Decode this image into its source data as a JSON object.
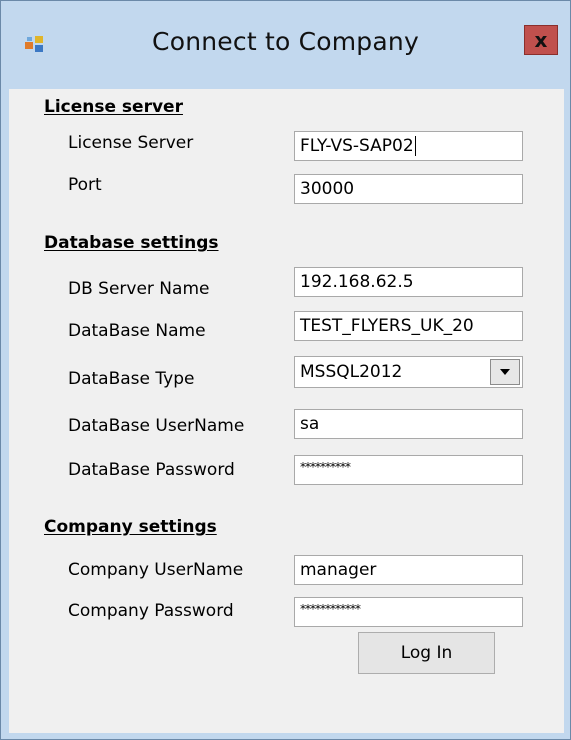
{
  "window": {
    "title": "Connect to Company",
    "close_label": "x"
  },
  "license_server": {
    "heading": "License server",
    "server_label": "License Server",
    "server_value": "FLY-VS-SAP02",
    "port_label": "Port",
    "port_value": "30000"
  },
  "database": {
    "heading": "Database settings",
    "server_name_label": "DB Server Name",
    "server_name_value": "192.168.62.5",
    "db_name_label": "DataBase Name",
    "db_name_value": "TEST_FLYERS_UK_20",
    "db_type_label": "DataBase Type",
    "db_type_value": "MSSQL2012",
    "username_label": "DataBase UserName",
    "username_value": "sa",
    "password_label": "DataBase Password",
    "password_value": "**********"
  },
  "company": {
    "heading": "Company settings",
    "username_label": "Company UserName",
    "username_value": "manager",
    "password_label": "Company Password",
    "password_value": "************"
  },
  "actions": {
    "login_label": "Log In"
  },
  "icons": {
    "app": "app-icon",
    "close": "close-icon",
    "dropdown": "chevron-down-icon"
  },
  "colors": {
    "title_bar": "#c2d8ee",
    "close_button": "#c0504d",
    "client_bg": "#f0f0f0"
  }
}
